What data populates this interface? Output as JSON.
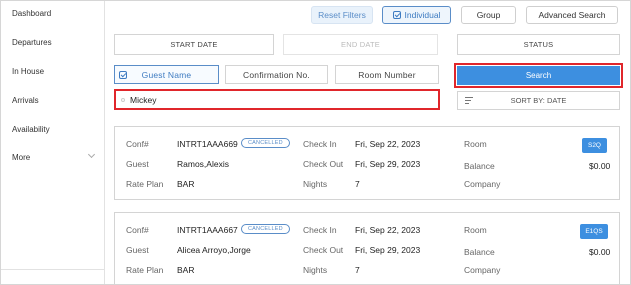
{
  "sidebar": {
    "items": [
      {
        "label": "Dashboard"
      },
      {
        "label": "Departures"
      },
      {
        "label": "In House"
      },
      {
        "label": "Arrivals"
      },
      {
        "label": "Availability"
      },
      {
        "label": "More"
      }
    ]
  },
  "toolbar": {
    "reset_label": "Reset Filters",
    "individual_label": "Individual",
    "group_label": "Group",
    "advanced_label": "Advanced Search"
  },
  "filters": {
    "start_date_label": "START DATE",
    "end_date_label": "END DATE",
    "status_label": "STATUS"
  },
  "search_type": {
    "guest_name_label": "Guest Name",
    "confirmation_label": "Confirmation No.",
    "room_number_label": "Room Number"
  },
  "search": {
    "button_label": "Search",
    "input_value": "Mickey",
    "sort_label": "SORT BY: DATE"
  },
  "colors": {
    "accent": "#3d8fe0",
    "highlight": "#e0262b"
  },
  "field_labels": {
    "conf": "Conf#",
    "guest": "Guest",
    "rate_plan": "Rate Plan",
    "check_in": "Check In",
    "check_out": "Check Out",
    "nights": "Nights",
    "room": "Room",
    "balance": "Balance",
    "company": "Company"
  },
  "reservations": [
    {
      "conf": "INTRT1AAA669",
      "status": "CANCELLED",
      "guest": "Ramos,Alexis",
      "rate_plan": "BAR",
      "check_in": "Fri, Sep 22, 2023",
      "check_out": "Fri, Sep 29, 2023",
      "nights": "7",
      "room": "S2Q",
      "balance": "$0.00"
    },
    {
      "conf": "INTRT1AAA667",
      "status": "CANCELLED",
      "guest": "Alicea Arroyo,Jorge",
      "rate_plan": "BAR",
      "check_in": "Fri, Sep 22, 2023",
      "check_out": "Fri, Sep 29, 2023",
      "nights": "7",
      "room": "E1QS",
      "balance": "$0.00"
    }
  ]
}
